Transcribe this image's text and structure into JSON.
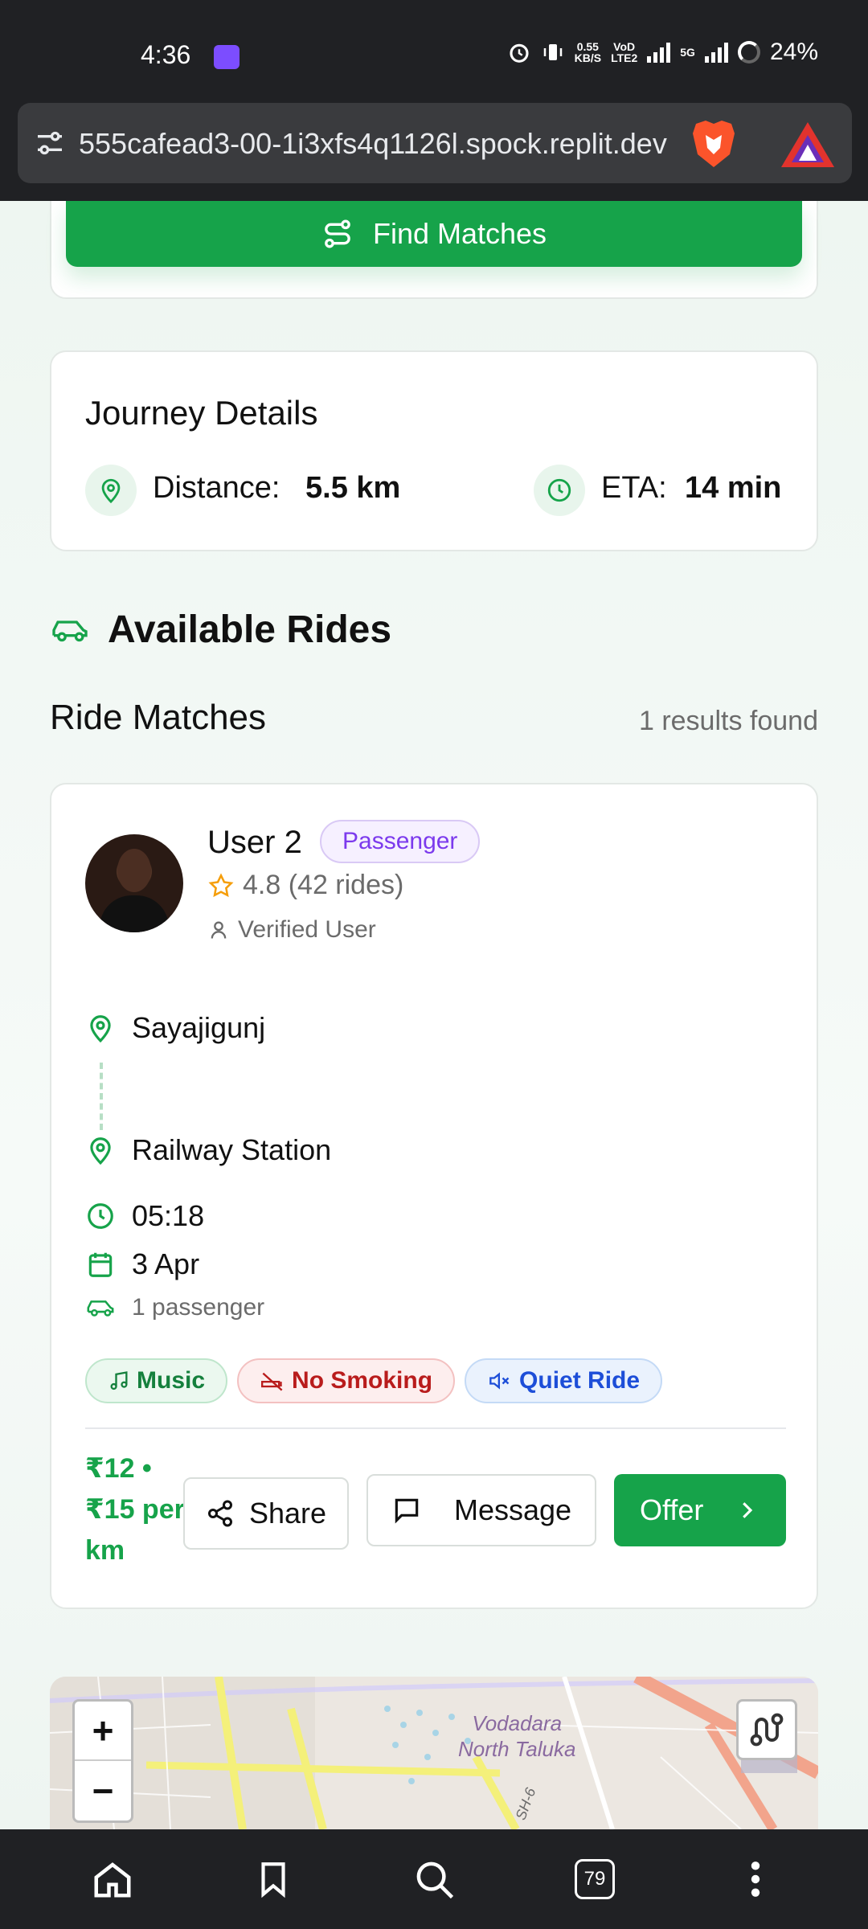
{
  "status_bar": {
    "time": "4:36",
    "net_speed_value": "0.55",
    "net_speed_unit": "KB/S",
    "volte_top": "VoD",
    "volte_bottom": "LTE2",
    "network_type": "5G",
    "battery": "24%"
  },
  "browser": {
    "url": "555cafead3-00-1i3xfs4q1126l.spock.replit.dev",
    "tab_count": "79"
  },
  "find_matches": {
    "label": "Find Matches"
  },
  "journey": {
    "title": "Journey Details",
    "distance_label": "Distance:",
    "distance_value": "5.5 km",
    "eta_label": "ETA:",
    "eta_value": "14 min"
  },
  "available": {
    "title": "Available Rides"
  },
  "ride_matches": {
    "title": "Ride Matches",
    "count_text": "1 results found"
  },
  "ride": {
    "user_name": "User 2",
    "role_badge": "Passenger",
    "rating": "4.8 (42 rides)",
    "verified": "Verified User",
    "pickup": "Sayajigunj",
    "dropoff": "Railway Station",
    "time": "05:18",
    "date": "3 Apr",
    "passengers": "1 passenger",
    "tags": {
      "music": "Music",
      "no_smoking": "No Smoking",
      "quiet": "Quiet Ride"
    },
    "price": "₹12 • ₹15 per km",
    "share_label": "Share",
    "message_label": "Message",
    "offer_label": "Offer"
  },
  "map": {
    "zoom_in": "+",
    "zoom_out": "−",
    "place_line1": "Vodadara",
    "place_line2": "North Taluka",
    "road_label": "SH-6"
  },
  "colors": {
    "accent_green": "#16a34a",
    "passenger_purple": "#7c3aed",
    "no_smoking_red": "#b91c1c",
    "quiet_blue": "#1d4ed8"
  }
}
